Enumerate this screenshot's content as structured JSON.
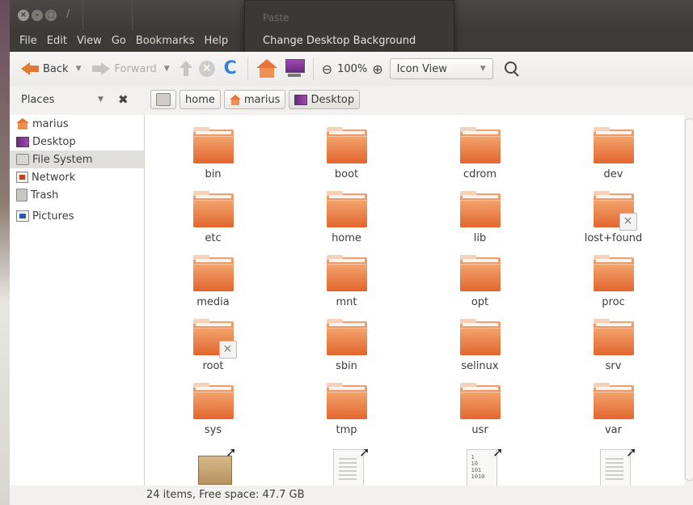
{
  "window": {
    "title": "/"
  },
  "menubar": [
    "File",
    "Edit",
    "View",
    "Go",
    "Bookmarks",
    "Help"
  ],
  "context_menu": {
    "items": [
      "Paste",
      "Change Desktop Background"
    ]
  },
  "toolbar": {
    "back_label": "Back",
    "forward_label": "Forward",
    "zoom_level": "100%",
    "view_mode": "Icon View"
  },
  "location": {
    "places_label": "Places",
    "breadcrumbs": [
      "home",
      "marius",
      "Desktop"
    ]
  },
  "sidebar": {
    "items": [
      {
        "label": "marius",
        "icon": "home-folder-icon"
      },
      {
        "label": "Desktop",
        "icon": "desktop-icon"
      },
      {
        "label": "File System",
        "icon": "drive-icon",
        "selected": true
      },
      {
        "label": "Network",
        "icon": "network-icon"
      },
      {
        "label": "Trash",
        "icon": "trash-icon"
      },
      {
        "label": "Pictures",
        "icon": "pictures-icon"
      }
    ]
  },
  "files": [
    {
      "name": "bin",
      "type": "folder"
    },
    {
      "name": "boot",
      "type": "folder"
    },
    {
      "name": "cdrom",
      "type": "folder"
    },
    {
      "name": "dev",
      "type": "folder"
    },
    {
      "name": "etc",
      "type": "folder"
    },
    {
      "name": "home",
      "type": "folder"
    },
    {
      "name": "lib",
      "type": "folder"
    },
    {
      "name": "lost+found",
      "type": "folder-locked"
    },
    {
      "name": "media",
      "type": "folder"
    },
    {
      "name": "mnt",
      "type": "folder"
    },
    {
      "name": "opt",
      "type": "folder"
    },
    {
      "name": "proc",
      "type": "folder"
    },
    {
      "name": "root",
      "type": "folder-locked"
    },
    {
      "name": "sbin",
      "type": "folder"
    },
    {
      "name": "selinux",
      "type": "folder"
    },
    {
      "name": "srv",
      "type": "folder"
    },
    {
      "name": "sys",
      "type": "folder"
    },
    {
      "name": "tmp",
      "type": "folder"
    },
    {
      "name": "usr",
      "type": "folder"
    },
    {
      "name": "var",
      "type": "folder"
    },
    {
      "name": "",
      "type": "package-link"
    },
    {
      "name": "",
      "type": "text-link"
    },
    {
      "name": "",
      "type": "binary-link",
      "glyph": "1\n10\n101\n1010"
    },
    {
      "name": "",
      "type": "text-link"
    }
  ],
  "status": {
    "text": "24 items, Free space: 47.7 GB"
  },
  "colors": {
    "accent": "#e8733a",
    "menubar": "#3c3b37",
    "reload": "#3d7fd6"
  }
}
